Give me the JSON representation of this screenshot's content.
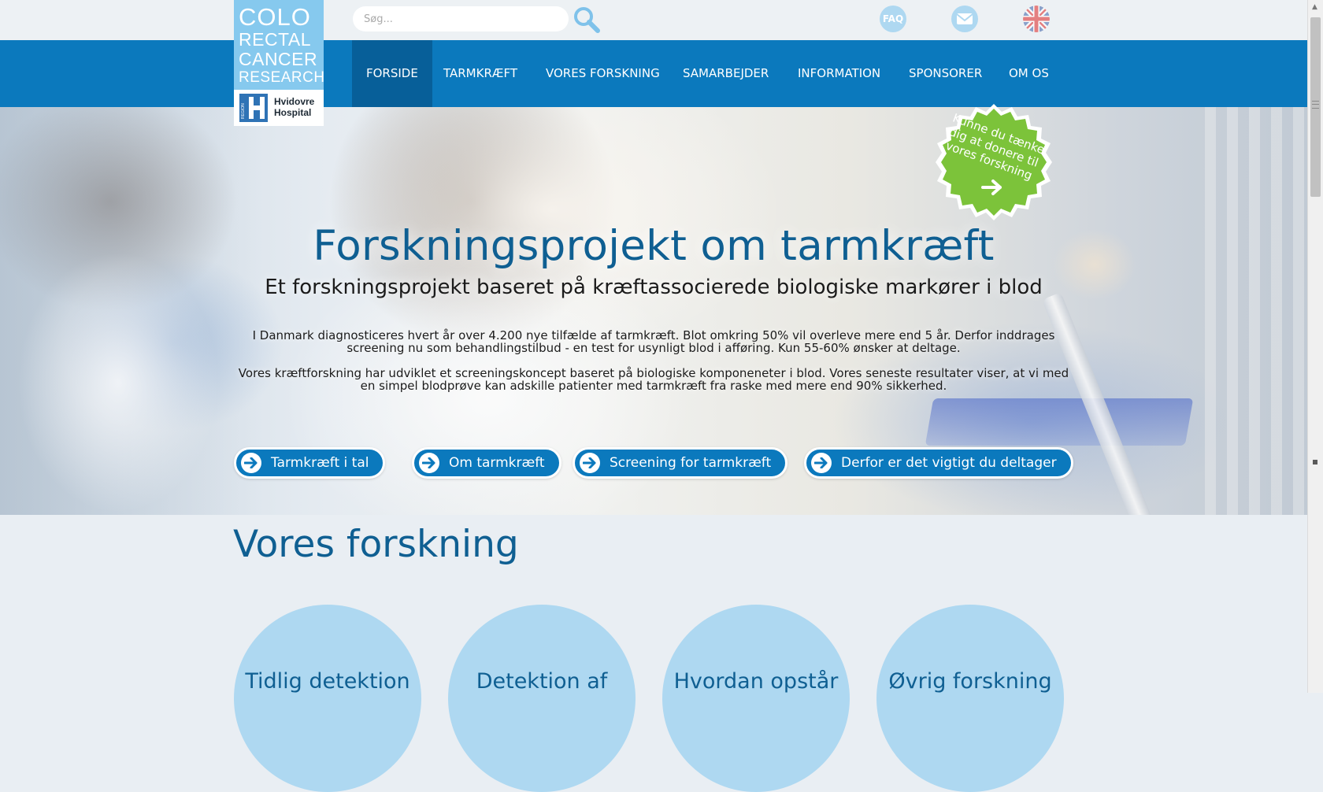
{
  "logo": {
    "line1": "COLO",
    "line2": "RECTAL",
    "line3": "CANCER",
    "line4": "RESEARCH",
    "region_label": "REGION",
    "hospital_line1": "Hvidovre",
    "hospital_line2": "Hospital"
  },
  "search": {
    "placeholder": "Søg...",
    "button_icon": "search-icon"
  },
  "top_icons": {
    "faq_label": "FAQ",
    "mail_icon": "mail-icon",
    "language_icon": "uk-flag-icon"
  },
  "nav": {
    "items": [
      {
        "label": "FORSIDE",
        "active": true
      },
      {
        "label": "TARMKRÆFT",
        "active": false
      },
      {
        "label": "VORES FORSKNING",
        "active": false
      },
      {
        "label": "SAMARBEJDER",
        "active": false
      },
      {
        "label": "INFORMATION",
        "active": false
      },
      {
        "label": "SPONSORER",
        "active": false
      },
      {
        "label": "OM OS",
        "active": false
      }
    ]
  },
  "hero": {
    "title": "Forskningsprojekt om tarmkræft",
    "subtitle": "Et forskningsprojekt baseret på kræftassocierede biologiske markører i blod",
    "paragraph1": "I Danmark diagnosticeres hvert år over 4.200 nye tilfælde af tarmkræft. Blot omkring 50% vil overleve mere end 5 år. Derfor inddrages screening nu som behandlingstilbud - en test for usynligt blod i afføring. Kun 55-60% ønsker at deltage.",
    "paragraph2": "Vores kræftforskning har udviklet et screeningskoncept baseret på biologiske komponeneter i blod. Vores seneste resultater viser, at vi med en simpel blodprøve kan adskille patienter med tarmkræft fra raske med mere end 90% sikkerhed.",
    "buttons": [
      {
        "label": "Tarmkræft i tal"
      },
      {
        "label": "Om tarmkræft"
      },
      {
        "label": "Screening for tarmkræft"
      },
      {
        "label": "Derfor er det vigtigt du deltager"
      }
    ],
    "badge": {
      "line1": "Kunne du tænke",
      "line2": "dig at donere til",
      "line3": "vores forskning"
    }
  },
  "research": {
    "title": "Vores forskning",
    "circles": [
      {
        "label": "Tidlig detektion"
      },
      {
        "label": "Detektion af"
      },
      {
        "label": "Hvordan opstår"
      },
      {
        "label": "Øvrig forskning"
      }
    ]
  },
  "colors": {
    "primary_blue": "#0b79bd",
    "active_nav": "#075f99",
    "heading_blue": "#0f5f92",
    "light_blue": "#aed8f1",
    "badge_green": "#7cc33a"
  }
}
